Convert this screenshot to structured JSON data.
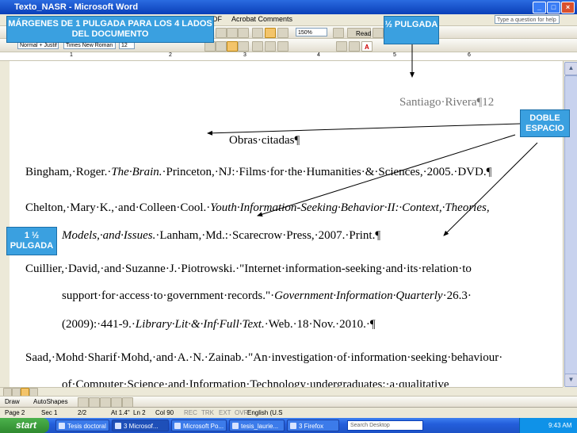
{
  "window": {
    "title": "Texto_NASR - Microsoft Word"
  },
  "menubar": {
    "items": [
      "PDF",
      "Acrobat Comments"
    ],
    "help_placeholder": "Type a question for help"
  },
  "toolbar": {
    "zoom": "150%",
    "read_label": "Read",
    "style": "Normal + Justif",
    "font": "Times New Roman",
    "size": "12"
  },
  "ruler": {
    "numbers": [
      "1",
      "2",
      "3",
      "4",
      "5",
      "6"
    ]
  },
  "document": {
    "header": "Santiago·Rivera¶12",
    "title": "Obras·citadas¶",
    "lines": [
      {
        "pre": "Bingham,·Roger.·",
        "it": "The·Brain.",
        "post": "·Princeton,·NJ:·Films·for·the·Humanities·&·Sciences,·2005.·DVD.¶"
      },
      {
        "pre": "Chelton,·Mary·K.,·and·Colleen·Cool.·",
        "it": "Youth·Information-Seeking·Behavior·II:·Context,·Theories,",
        "post": ""
      },
      {
        "pre": "",
        "it": "Models,·and·Issues.",
        "post": "·Lanham,·Md.:·Scarecrow·Press,·2007.·Print.¶"
      },
      {
        "pre": "Cuillier,·David,·and·Suzanne·J.·Piotrowski.·\"Internet·information-seeking·and·its·relation·to",
        "it": "",
        "post": ""
      },
      {
        "pre": "support·for·access·to·government·records.\"·",
        "it": "Government·Information·Quarterly",
        "post": "·26.3·"
      },
      {
        "pre": "(2009):·441-9.·",
        "it": "Library·Lit·&·Inf·Full·Text.",
        "post": "·Web.·18·Nov.·2010.·¶"
      },
      {
        "pre": "Saad,·Mohd·Sharif·Mohd,·and·A.·N.·Zainab.·\"An·investigation·of·information·seeking·behaviour·",
        "it": "",
        "post": ""
      },
      {
        "pre": "of·Computer·Science·and·Information·Technology·undergraduates:·a·qualitative",
        "it": "",
        "post": ""
      }
    ]
  },
  "drawbar": {
    "draw": "Draw",
    "autoshapes": "AutoShapes"
  },
  "status": {
    "page": "Page 2",
    "sec": "Sec 1",
    "pages": "2/2",
    "at": "At 1.4\"",
    "ln": "Ln 2",
    "col": "Col 90",
    "rec": "REC",
    "trk": "TRK",
    "ext": "EXT",
    "ovr": "OVR",
    "lang": "English (U.S"
  },
  "taskbar": {
    "start": "start",
    "tasks": [
      "Tesis doctoral",
      "3 Microsof...",
      "Microsoft Po...",
      "tesis_laurie...",
      "3 Firefox"
    ],
    "search": "Search Desktop",
    "clock": "9:43 AM"
  },
  "annotations": {
    "margins": "MÁRGENES DE 1 PULGADA PARA LOS 4 LADOS DEL DOCUMENTO",
    "half_inch": "½ PULGADA",
    "double_space": "DOBLE ESPACIO",
    "one_half_inch": "1 ½ PULGADA"
  },
  "colors": {
    "annotation": "#3aa0e0",
    "titlebar": "#0a3fb8"
  }
}
